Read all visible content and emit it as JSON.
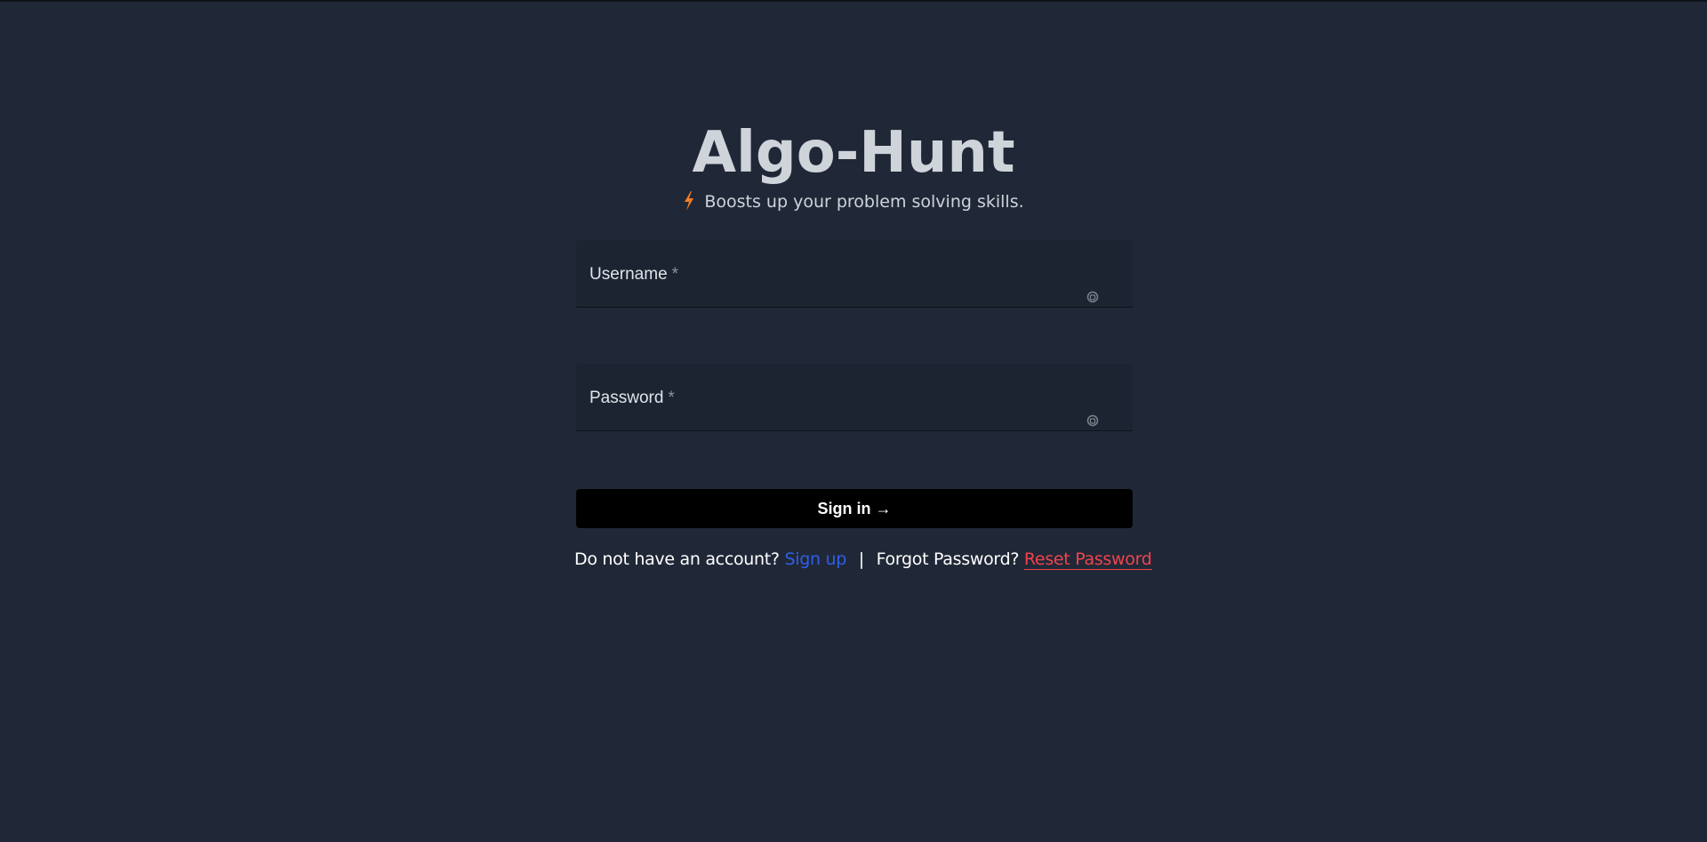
{
  "brand": {
    "title": "Algo-Hunt",
    "tagline": "Boosts up your problem solving skills.",
    "tagline_icon": "lightning-bolt-icon",
    "accent_color": "#f27d27"
  },
  "form": {
    "username": {
      "label": "Username",
      "required_mark": "*",
      "value": ""
    },
    "password": {
      "label": "Password",
      "required_mark": "*",
      "value": ""
    },
    "signin_label": "Sign in →"
  },
  "footer": {
    "no_account_text": "Do not have an account?",
    "signup_label": "Sign up",
    "separator": "|",
    "forgot_text": "Forgot Password?",
    "reset_label": "Reset Password",
    "signup_color": "#2f5fe6",
    "reset_color": "#f0444c"
  }
}
